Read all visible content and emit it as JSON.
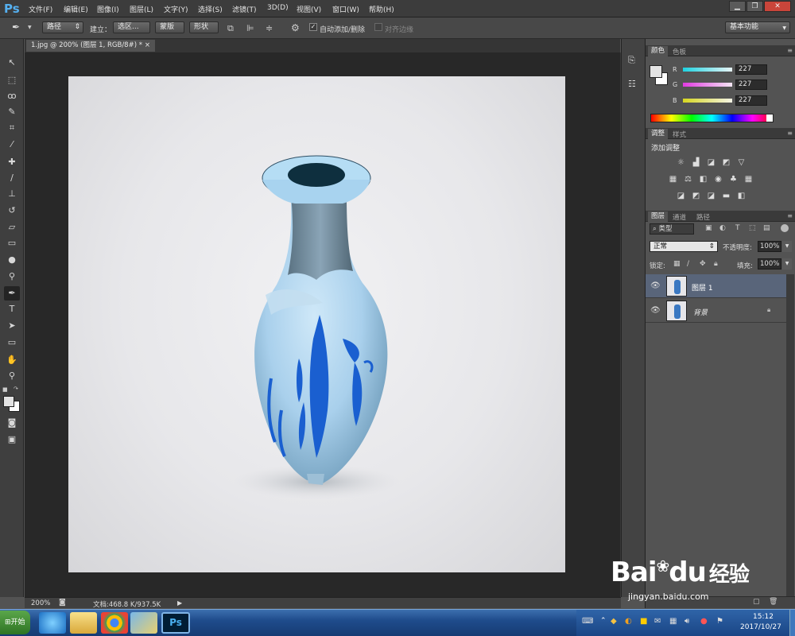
{
  "app": {
    "logo": "Ps"
  },
  "menu": [
    "文件(F)",
    "编辑(E)",
    "图像(I)",
    "图层(L)",
    "文字(Y)",
    "选择(S)",
    "滤镜(T)",
    "3D(D)",
    "视图(V)",
    "窗口(W)",
    "帮助(H)"
  ],
  "window_controls": {
    "minimize": "▁",
    "restore": "❐",
    "close": "✕"
  },
  "options": {
    "pen_mode": "路径",
    "create_label": "建立：",
    "selection_btn": "选区...",
    "mask_btn": "蒙版",
    "shape_btn": "形状",
    "auto_add_delete": "自动添加/删除",
    "align_edges": "对齐边缘",
    "workspace": "基本功能"
  },
  "document": {
    "tab_title": "1.jpg @ 200% (图层 1, RGB/8#) *",
    "close": "×"
  },
  "status": {
    "zoom": "200%",
    "doc_info": "文档:468.8 K/937.5K"
  },
  "color_panel": {
    "tabs": [
      "颜色",
      "色板"
    ],
    "channels": [
      {
        "label": "R",
        "value": "227",
        "color": "#40d9e8"
      },
      {
        "label": "G",
        "value": "227",
        "color": "#e05ce0"
      },
      {
        "label": "B",
        "value": "227",
        "color": "#dede30"
      }
    ]
  },
  "adjustments_panel": {
    "tabs": [
      "调整",
      "样式"
    ],
    "title": "添加调整"
  },
  "layers_panel": {
    "tabs": [
      "图层",
      "通道",
      "路径"
    ],
    "filter": "类型",
    "blend_mode": "正常",
    "opacity_label": "不透明度:",
    "opacity_value": "100%",
    "lock_label": "锁定:",
    "fill_label": "填充:",
    "fill_value": "100%",
    "layers": [
      {
        "name": "图层 1",
        "selected": true,
        "locked": false
      },
      {
        "name": "背景",
        "selected": false,
        "locked": true
      }
    ]
  },
  "taskbar": {
    "start": "开始",
    "time": "15:12",
    "date": "2017/10/27"
  },
  "watermark": {
    "brand": "Bai",
    "paw": "du",
    "chinese": "经验",
    "url": "jingyan.baidu.com"
  },
  "colors": {
    "vase_light": "#b7d9ef",
    "vase_shadow": "#6f8a9c",
    "vase_pattern": "#1a5fd0",
    "accent_selected_layer": "#59657a"
  }
}
